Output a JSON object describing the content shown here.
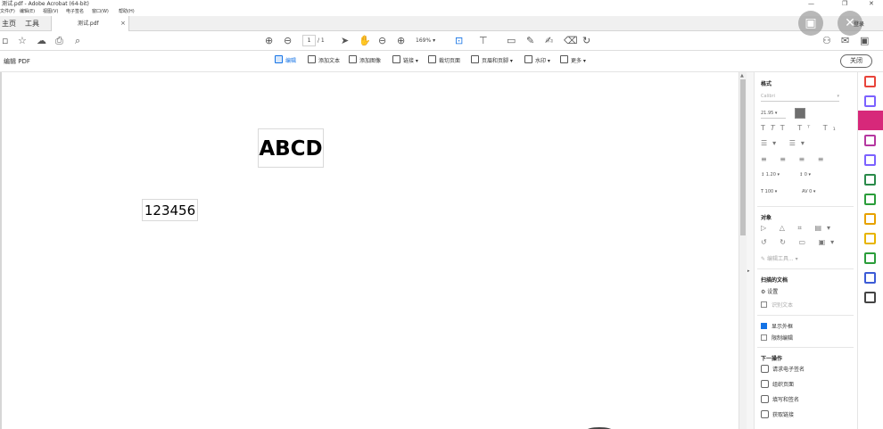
{
  "window": {
    "title": "测试.pdf - Adobe Acrobat (64-bit)",
    "controls": [
      "—",
      "❐",
      "✕"
    ]
  },
  "menu": [
    "文件(F)",
    "编辑(E)",
    "视图(V)",
    "电子签名",
    "窗口(W)",
    "帮助(H)"
  ],
  "tabs": {
    "home": "主页",
    "tools": "工具",
    "document": "测试.pdf",
    "close": "×"
  },
  "toolbar": {
    "page_current": "1",
    "page_total": "/ 1",
    "zoom": "169%",
    "login": "登录"
  },
  "editbar": {
    "title": "编辑 PDF",
    "tools": [
      "编辑",
      "添加文本",
      "添加图像",
      "链接 ▾",
      "裁切页面",
      "页眉和页脚 ▾",
      "水印 ▾",
      "更多 ▾"
    ],
    "close": "关闭"
  },
  "document": {
    "heading": "ABCD",
    "numbers": "123456"
  },
  "panel": {
    "format": {
      "title": "格式",
      "font": "Calibri",
      "font_size": "21.95",
      "line_spacing": "1.20",
      "para_spacing": "0",
      "scale": "100",
      "char_spacing": "0"
    },
    "objects": {
      "title": "对象",
      "edit_tool": "编辑工具..."
    },
    "scanned": {
      "title": "扫描的文档",
      "settings": "设置",
      "recognize": "识别文本"
    },
    "show_frame": "显示外框",
    "restrict_edit": "限制编辑",
    "next": {
      "title": "下一操作",
      "items": [
        "请求电子签名",
        "组织页面",
        "填写和签名",
        "获取链接"
      ]
    }
  },
  "colors": {
    "accent": "#1473e6",
    "rail_active": "#d7287a",
    "rail_icons": [
      "#e8443a",
      "#7b61ff",
      "#d7287a",
      "#b5379f",
      "#7b61ff",
      "#2a8a4a",
      "#2a9d3a",
      "#e7a100",
      "#e7b400",
      "#2a9d3a",
      "#3c5bd6",
      "#444444"
    ]
  }
}
